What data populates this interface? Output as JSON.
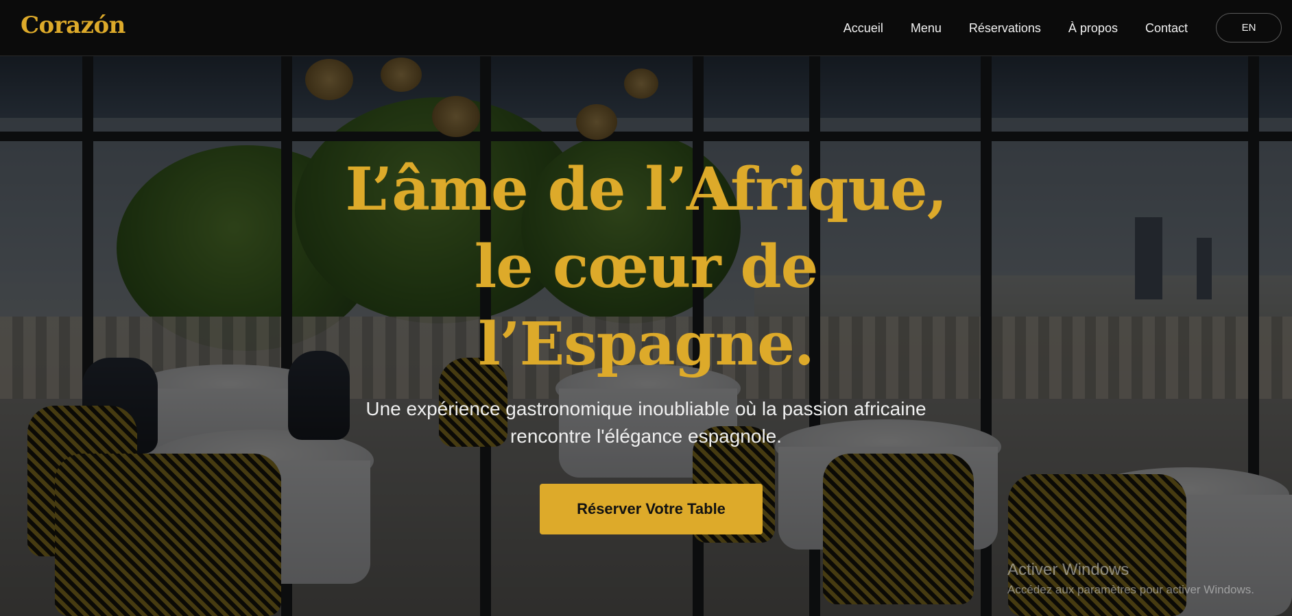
{
  "brand": {
    "logo_text": "Corazón",
    "accent_color": "#ddaa2a"
  },
  "nav": {
    "items": [
      {
        "label": "Accueil"
      },
      {
        "label": "Menu"
      },
      {
        "label": "Réservations"
      },
      {
        "label": "À propos"
      },
      {
        "label": "Contact"
      }
    ],
    "language_button": "EN"
  },
  "hero": {
    "title_lines": [
      "L’âme de l’Afrique,",
      "le cœur de",
      "l’Espagne."
    ],
    "subtitle_lines": [
      "Une expérience gastronomique inoubliable où la passion africaine",
      "rencontre l'élégance espagnole."
    ],
    "cta_label": "Réserver Votre Table",
    "background_image": "restaurant-dining-room-photo"
  },
  "os_watermark": {
    "title": "Activer Windows",
    "subtitle": "Accédez aux paramètres pour activer Windows."
  }
}
